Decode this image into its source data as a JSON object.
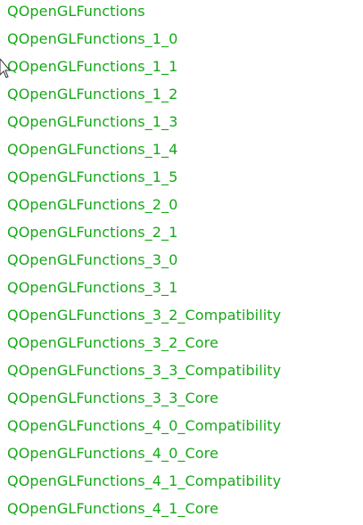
{
  "link_color": "#17a81a",
  "classes": [
    "QOpenGLFunctions",
    "QOpenGLFunctions_1_0",
    "QOpenGLFunctions_1_1",
    "QOpenGLFunctions_1_2",
    "QOpenGLFunctions_1_3",
    "QOpenGLFunctions_1_4",
    "QOpenGLFunctions_1_5",
    "QOpenGLFunctions_2_0",
    "QOpenGLFunctions_2_1",
    "QOpenGLFunctions_3_0",
    "QOpenGLFunctions_3_1",
    "QOpenGLFunctions_3_2_Compatibility",
    "QOpenGLFunctions_3_2_Core",
    "QOpenGLFunctions_3_3_Compatibility",
    "QOpenGLFunctions_3_3_Core",
    "QOpenGLFunctions_4_0_Compatibility",
    "QOpenGLFunctions_4_0_Core",
    "QOpenGLFunctions_4_1_Compatibility",
    "QOpenGLFunctions_4_1_Core"
  ],
  "cursor_icon": "mouse-pointer-icon"
}
